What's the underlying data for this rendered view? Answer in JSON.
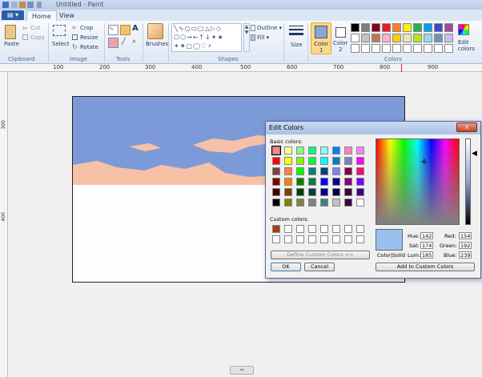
{
  "window": {
    "title": "Untitled - Paint"
  },
  "tabs": {
    "file": "",
    "home": "Home",
    "view": "View"
  },
  "ribbon": {
    "clipboard": {
      "paste": "Paste",
      "cut": "Cut",
      "copy": "Copy",
      "group": "Clipboard"
    },
    "image": {
      "select": "Select",
      "crop": "Crop",
      "resize": "Resize",
      "rotate": "Rotate",
      "group": "Image"
    },
    "tools": {
      "group": "Tools"
    },
    "brushes": {
      "label": "Brushes"
    },
    "shapes": {
      "outline": "Outline",
      "fill": "Fill",
      "group": "Shapes"
    },
    "size": {
      "label": "Size"
    },
    "colors": {
      "color1": "Color",
      "color1_num": "1",
      "color2": "Color",
      "color2_num": "2",
      "edit": "Edit",
      "edit2": "colors",
      "group": "Colors",
      "color1_value": "#8aa4d6",
      "palette": [
        "#000000",
        "#7f7f7f",
        "#880015",
        "#ed1c24",
        "#ff7f27",
        "#fff200",
        "#22b14c",
        "#00a2e8",
        "#3f48cc",
        "#a349a4",
        "#ffffff",
        "#c3c3c3",
        "#b97a57",
        "#ffaec9",
        "#ffc90e",
        "#efe4b0",
        "#b5e61d",
        "#99d9ea",
        "#7092be",
        "#c8bfe7",
        "#ffffff",
        "#ffffff",
        "#ffffff",
        "#ffffff",
        "#ffffff",
        "#ffffff",
        "#ffffff",
        "#ffffff",
        "#ffffff",
        "#ffffff"
      ]
    }
  },
  "ruler": {
    "top": [
      "100",
      "200",
      "300",
      "400",
      "500",
      "600",
      "700",
      "800",
      "900"
    ],
    "left": [
      "300",
      "400"
    ]
  },
  "canvas": {
    "sky_color": "#7d9ad8",
    "cloud_color": "#f7c1a8"
  },
  "dialog": {
    "title": "Edit Colors",
    "close": "x",
    "basic_colors": "Basic colors:",
    "custom_colors": "Custom colors:",
    "define_custom": "Define Custom Colors >>",
    "ok": "OK",
    "cancel": "Cancel",
    "color_solid": "Color|Solid",
    "add_custom": "Add to Custom Colors",
    "hue_label": "Hue:",
    "hue": "142",
    "sat_label": "Sat:",
    "sat": "174",
    "lum_label": "Lum:",
    "lum": "185",
    "red_label": "Red:",
    "red": "154",
    "green_label": "Green:",
    "green": "192",
    "blue_label": "Blue:",
    "blue": "239",
    "preview_color": "#9ac0ef",
    "basic": [
      "#ff8080",
      "#ffff80",
      "#80ff80",
      "#00ff80",
      "#80ffff",
      "#0080ff",
      "#ff80c0",
      "#ff80ff",
      "#ff0000",
      "#ffff00",
      "#80ff00",
      "#00ff40",
      "#00ffff",
      "#0080c0",
      "#8080c0",
      "#ff00ff",
      "#804040",
      "#ff8040",
      "#00ff00",
      "#008080",
      "#004080",
      "#8080ff",
      "#800040",
      "#ff0080",
      "#800000",
      "#ff8000",
      "#008000",
      "#008040",
      "#0000ff",
      "#0000a0",
      "#800080",
      "#8000ff",
      "#400000",
      "#804000",
      "#004000",
      "#004040",
      "#000080",
      "#000040",
      "#400040",
      "#400080",
      "#000000",
      "#808000",
      "#808040",
      "#808080",
      "#408080",
      "#c0c0c0",
      "#400040",
      "#ffffff"
    ],
    "custom": [
      "#a0401a",
      "#ffffff",
      "#ffffff",
      "#ffffff",
      "#ffffff",
      "#ffffff",
      "#ffffff",
      "#ffffff",
      "#ffffff",
      "#ffffff",
      "#ffffff",
      "#ffffff",
      "#ffffff",
      "#ffffff",
      "#ffffff",
      "#ffffff"
    ]
  },
  "scroll": {
    "grip": "≈"
  }
}
